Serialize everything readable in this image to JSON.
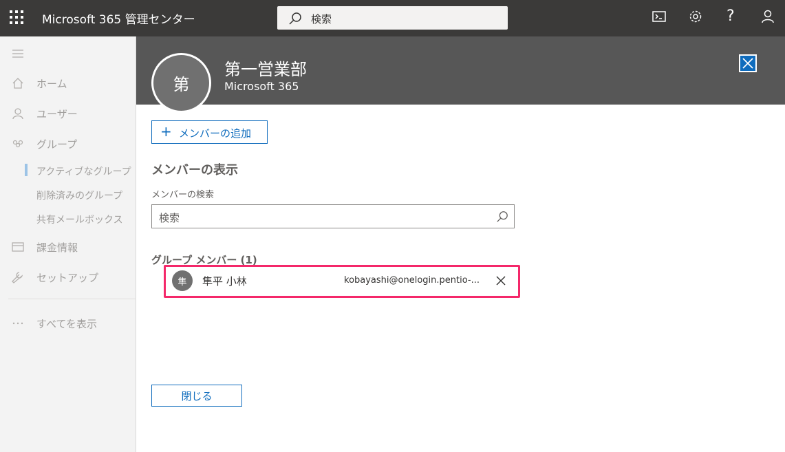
{
  "header": {
    "app_title": "Microsoft 365 管理センター",
    "search_placeholder": "検索",
    "icons": [
      "waffle-icon",
      "terminal-icon",
      "gear-icon",
      "help-icon",
      "user-icon"
    ],
    "help_glyph": "?"
  },
  "leftnav": {
    "items": [
      {
        "label": "ホーム",
        "icon": "home-icon"
      },
      {
        "label": "ユーザー",
        "icon": "person-icon"
      },
      {
        "label": "グループ",
        "icon": "group-icon"
      },
      {
        "label": "課金情報",
        "icon": "billing-icon"
      },
      {
        "label": "セットアップ",
        "icon": "wrench-icon"
      },
      {
        "label": "すべてを表示",
        "icon": "more-icon"
      }
    ],
    "group_sub": [
      {
        "label": "アクティブなグループ"
      },
      {
        "label": "削除済みのグループ"
      },
      {
        "label": "共有メールボックス"
      }
    ]
  },
  "panel": {
    "avatar_initial": "第",
    "group_name": "第一営業部",
    "group_type": "Microsoft 365",
    "add_member_plus": "+",
    "add_member_label": "メンバーの追加",
    "section_title": "メンバーの表示",
    "search_label": "メンバーの検索",
    "search_placeholder": "検索",
    "members_title": "グループ メンバー (1)",
    "members": [
      {
        "initial": "隼",
        "name": "隼平 小林",
        "email": "kobayashi@onelogin.pentio-..."
      }
    ],
    "close_label": "閉じる"
  },
  "colors": {
    "topbar": "#3b3a39",
    "accent": "#0f6cbd",
    "highlight": "#f4286a",
    "panel_header": "#575757"
  }
}
